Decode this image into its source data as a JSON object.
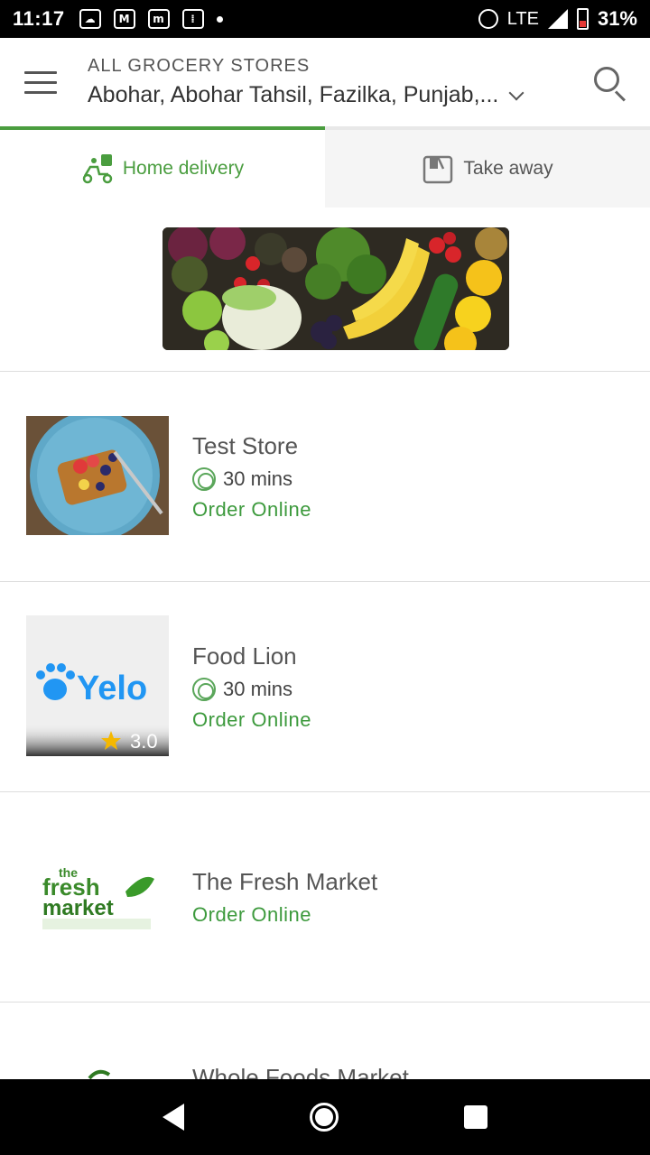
{
  "status_bar": {
    "time": "11:17",
    "network": "LTE",
    "battery": "31%"
  },
  "header": {
    "title": "ALL GROCERY STORES",
    "address": "Abohar, Abohar Tahsil, Fazilka, Punjab,..."
  },
  "tabs": [
    {
      "label": "Home delivery",
      "active": true
    },
    {
      "label": "Take away",
      "active": false
    }
  ],
  "stores": [
    {
      "name": "Test Store",
      "time": "30 mins",
      "action": "Order Online"
    },
    {
      "name": "Food Lion",
      "time": "30 mins",
      "action": "Order Online",
      "logo_text": "Yelo",
      "rating": "3.0"
    },
    {
      "name": "The Fresh Market",
      "action": "Order Online",
      "logo_text": [
        "the",
        "fresh",
        "market"
      ]
    },
    {
      "name": "Whole Foods Market"
    }
  ],
  "colors": {
    "accent": "#4a9d3f",
    "order_online": "#3d9a3d",
    "yelo_blue": "#2196f3",
    "star": "#f5b800"
  }
}
